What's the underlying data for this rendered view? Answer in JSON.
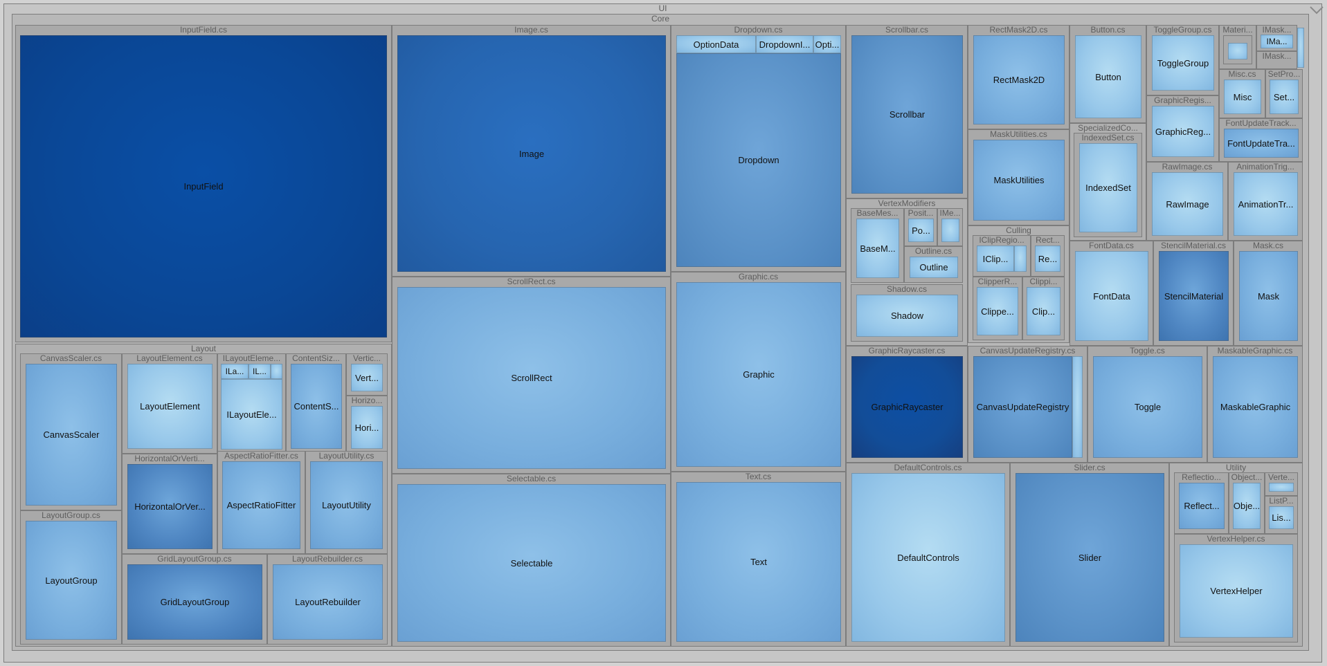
{
  "groups": {
    "ui": "UI",
    "core": "Core",
    "layout": "Layout",
    "vertex_modifiers": "VertexModifiers",
    "culling": "Culling",
    "specialized_collections": "SpecializedCo...",
    "utility": "Utility"
  },
  "files": {
    "inputfield": "InputField.cs",
    "image": "Image.cs",
    "dropdown": "Dropdown.cs",
    "scrollbar": "Scrollbar.cs",
    "rectmask2d": "RectMask2D.cs",
    "button": "Button.cs",
    "togglegroup": "ToggleGroup.cs",
    "materialmod": "Materi...",
    "imaskable": "IMask...",
    "imaskable2": "IMask...",
    "misc": "Misc.cs",
    "setpropertyutility": "SetPro...",
    "graphicregistry": "GraphicRegis...",
    "fontupdatetracker": "FontUpdateTrack...",
    "maskutilities": "MaskUtilities.cs",
    "indexedset": "IndexedSet.cs",
    "rawimage": "RawImage.cs",
    "animationtriggers": "AnimationTrig...",
    "basemesheffect": "BaseMes...",
    "positionasuv1": "Posit...",
    "imeshmodifier": "IMe...",
    "outline": "Outline.cs",
    "shadow": "Shadow.cs",
    "iclipregion": "IClipRegio...",
    "rectangularvertexclipper": "Rect...",
    "clipperregistry": "ClipperR...",
    "clipping": "Clippi...",
    "fontdata": "FontData.cs",
    "stencilmaterial": "StencilMaterial.cs",
    "mask": "Mask.cs",
    "scrollrect": "ScrollRect.cs",
    "graphic": "Graphic.cs",
    "graphicraycaster": "GraphicRaycaster.cs",
    "canvasupdateregistry": "CanvasUpdateRegistry.cs",
    "toggle": "Toggle.cs",
    "maskablegraphic": "MaskableGraphic.cs",
    "canvasscaler": "CanvasScaler.cs",
    "layoutelement": "LayoutElement.cs",
    "ilayoutelement": "ILayoutEleme...",
    "contentsizefitter": "ContentSiz...",
    "verticallayoutgroup": "Vertic...",
    "horizontallayoutgroup": "Horizo...",
    "horizontalorvertical": "HorizontalOrVerti...",
    "aspectratiofitter": "AspectRatioFitter.cs",
    "layoututility": "LayoutUtility.cs",
    "layoutgroup": "LayoutGroup.cs",
    "gridlayoutgroup": "GridLayoutGroup.cs",
    "layoutrebuilder": "LayoutRebuilder.cs",
    "selectable": "Selectable.cs",
    "text": "Text.cs",
    "defaultcontrols": "DefaultControls.cs",
    "slider": "Slider.cs",
    "reflectionmethods": "Reflectio...",
    "objectpool": "Object...",
    "vertexhelper_small": "Verte...",
    "listpool": "ListP...",
    "vertexhelper": "VertexHelper.cs"
  },
  "classes": {
    "inputfield": "InputField",
    "image": "Image",
    "optiondata": "OptionData",
    "dropdownitem": "DropdownI...",
    "optiondatalist": "Opti...",
    "dropdown": "Dropdown",
    "scrollbar": "Scrollbar",
    "rectmask2d": "RectMask2D",
    "button": "Button",
    "togglegroup": "ToggleGroup",
    "imaskable": "IMa...",
    "misc": "Misc",
    "setpropertyutility": "Set...",
    "graphicregistry": "GraphicReg...",
    "fontupdatetracker": "FontUpdateTra...",
    "maskutilities": "MaskUtilities",
    "indexedset": "IndexedSet",
    "rawimage": "RawImage",
    "animationtriggers": "AnimationTr...",
    "basemesheffect": "BaseM...",
    "positionasuv1": "Po...",
    "outline": "Outline",
    "shadow": "Shadow",
    "iclipper": "IClip...",
    "rectangularvertexclipper": "Re...",
    "clipperregistry": "Clippe...",
    "clipping": "Clip...",
    "fontdata": "FontData",
    "stencilmaterial": "StencilMaterial",
    "mask": "Mask",
    "scrollrect": "ScrollRect",
    "graphic": "Graphic",
    "graphicraycaster": "GraphicRaycaster",
    "canvasupdateregistry": "CanvasUpdateRegistry",
    "toggle": "Toggle",
    "maskablegraphic": "MaskableGraphic",
    "canvasscaler": "CanvasScaler",
    "layoutelement": "LayoutElement",
    "ilayoutelement_a": "ILa...",
    "ilayoutelement_b": "IL...",
    "ilayoutelement": "ILayoutEle...",
    "contentsizefitter": "ContentS...",
    "verticallayoutgroup": "Vert...",
    "horizontallayoutgroup": "Hori...",
    "horizontalorvertical": "HorizontalOrVer...",
    "aspectratiofitter": "AspectRatioFitter",
    "layoututility": "LayoutUtility",
    "layoutgroup": "LayoutGroup",
    "gridlayoutgroup": "GridLayoutGroup",
    "layoutrebuilder": "LayoutRebuilder",
    "selectable": "Selectable",
    "text": "Text",
    "defaultcontrols": "DefaultControls",
    "slider": "Slider",
    "reflectionmethods": "Reflect...",
    "objectpool": "Obje...",
    "listpool": "Lis...",
    "vertexhelper": "VertexHelper"
  }
}
